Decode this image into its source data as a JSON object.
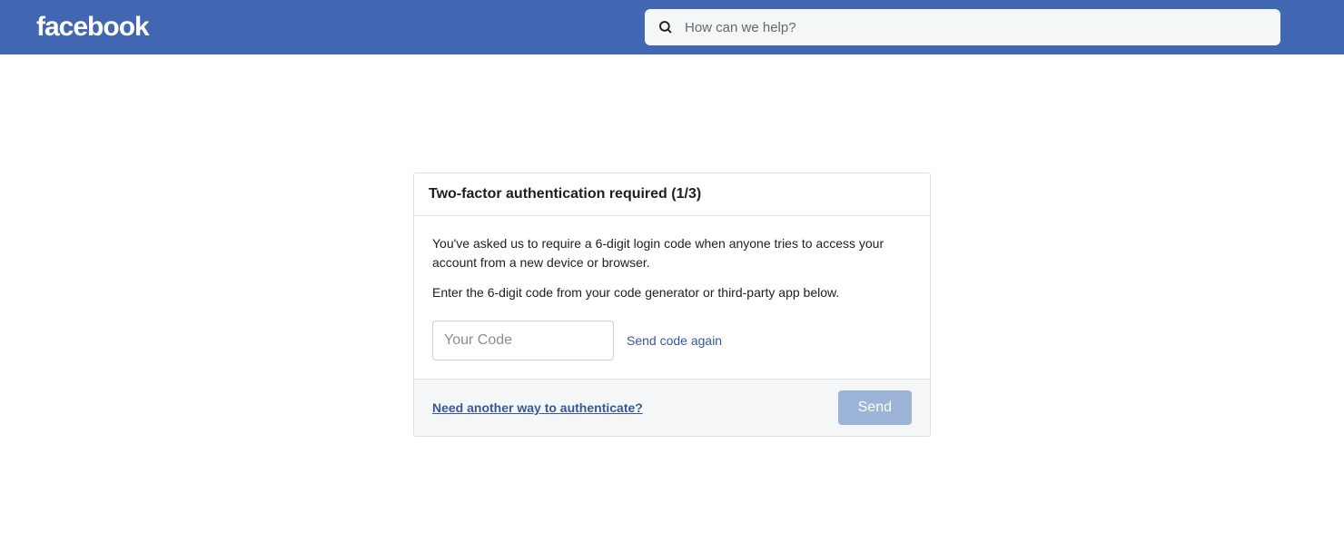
{
  "header": {
    "logo_text": "facebook",
    "search_placeholder": "How can we help?"
  },
  "card": {
    "title": "Two-factor authentication required (1/3)",
    "paragraph1": "You've asked us to require a 6-digit login code when anyone tries to access your account from a new device or browser.",
    "paragraph2": "Enter the 6-digit code from your code generator or third-party app below.",
    "code_input_placeholder": "Your Code",
    "resend_link": "Send code again",
    "alt_auth_link": "Need another way to authenticate?",
    "send_button": "Send"
  }
}
